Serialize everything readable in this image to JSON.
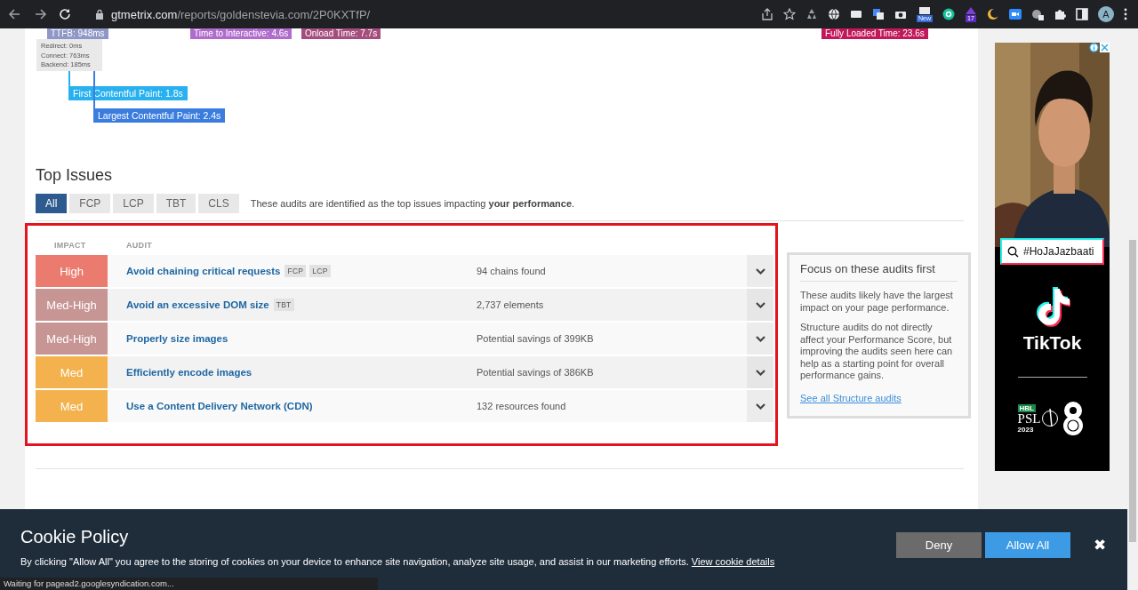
{
  "browser": {
    "url_domain": "gtmetrix.com",
    "url_path": "/reports/goldenstevia.com/2P0KXTfP/",
    "badges": [
      "New",
      "17"
    ],
    "profile": "A"
  },
  "timeline": {
    "markers": [
      {
        "label": "TTFB: 948ms",
        "color": "#8e97c6"
      },
      {
        "label": "Time to Interactive: 4.6s",
        "color": "#b06ccc"
      },
      {
        "label": "Onload Time: 7.7s",
        "color": "#a54d7c"
      },
      {
        "label": "Fully Loaded Time: 23.6s",
        "color": "#c2185b"
      }
    ],
    "ttfb_details": [
      "Redirect: 0ms",
      "Connect: 763ms",
      "Backend: 185ms"
    ],
    "paints": [
      {
        "label": "First Contentful Paint: 1.8s",
        "color": "#29b1ef"
      },
      {
        "label": "Largest Contentful Paint: 2.4s",
        "color": "#3b7ddf"
      }
    ]
  },
  "top_issues": {
    "title": "Top Issues",
    "tabs": [
      {
        "label": "All",
        "selected": true
      },
      {
        "label": "FCP",
        "selected": false
      },
      {
        "label": "LCP",
        "selected": false
      },
      {
        "label": "TBT",
        "selected": false
      },
      {
        "label": "CLS",
        "selected": false
      }
    ],
    "description": "These audits are identified as the top issues impacting **your performance**.",
    "columns": [
      "IMPACT",
      "AUDIT"
    ],
    "rows": [
      {
        "impact": "High",
        "color": "#ec7b6f",
        "audit": "Avoid chaining critical requests",
        "tags": [
          "FCP",
          "LCP"
        ],
        "detail": "94 chains found"
      },
      {
        "impact": "Med-High",
        "color": "#c89595",
        "audit": "Avoid an excessive DOM size",
        "tags": [
          "TBT"
        ],
        "detail": "2,737 elements"
      },
      {
        "impact": "Med-High",
        "color": "#c89595",
        "audit": "Properly size images",
        "detail": "Potential savings of 399KB"
      },
      {
        "impact": "Med",
        "color": "#f4b24e",
        "audit": "Efficiently encode images",
        "detail": "Potential savings of 386KB"
      },
      {
        "impact": "Med",
        "color": "#f4b24e",
        "audit": "Use a Content Delivery Network (CDN)",
        "detail": "132 resources found"
      }
    ]
  },
  "focus_panel": {
    "title": "Focus on these audits first",
    "paragraphs": [
      "These audits likely have the largest impact on your page performance.",
      "Structure audits do not directly affect your Performance Score, but improving the audits seen here can help as a starting point for overall performance gains."
    ],
    "link": "See all Structure audits"
  },
  "ad": {
    "search_text": "#HoJaJazbaati",
    "brand": "TikTok",
    "sponsor": "HBL",
    "league": "PSL",
    "year": "2023"
  },
  "cookie_banner": {
    "title": "Cookie Policy",
    "text": "By clicking \"Allow All\" you agree to the storing of cookies on your device to enhance site navigation, analyze site usage, and assist in our marketing efforts.",
    "link": "View cookie details",
    "buttons": [
      {
        "label": "Deny",
        "kind": "secondary"
      },
      {
        "label": "Allow All",
        "kind": "primary"
      }
    ],
    "close": "✖"
  },
  "status_bar": "Waiting for pagead2.googlesyndication.com..."
}
